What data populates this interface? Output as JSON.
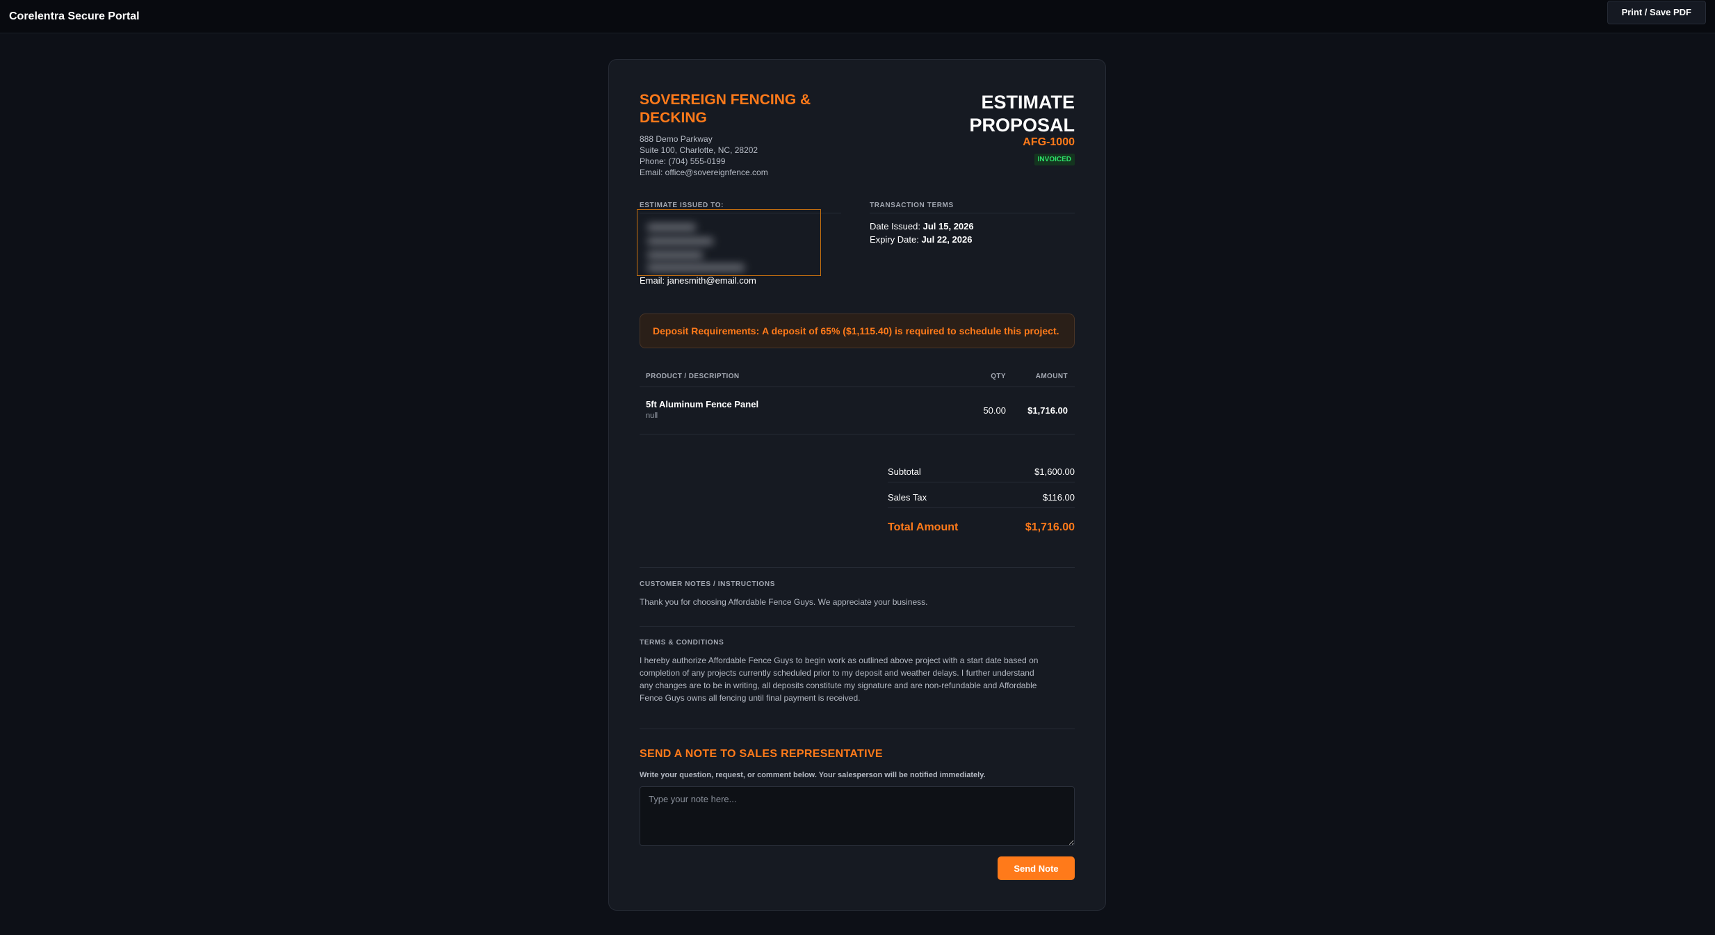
{
  "portal": {
    "title": "Corelentra Secure Portal",
    "print_label": "Print / Save PDF"
  },
  "company": {
    "name": "SOVEREIGN FENCING & DECKING",
    "address_line1": "888 Demo Parkway",
    "address_line2": "Suite 100, Charlotte, NC, 28202",
    "phone": "Phone: (704) 555-0199",
    "email": "Email: office@sovereignfence.com"
  },
  "document": {
    "title": "ESTIMATE PROPOSAL",
    "number": "AFG-1000",
    "status": "INVOICED"
  },
  "issued_to": {
    "label": "ESTIMATE ISSUED TO:",
    "email_label": "Email:",
    "email": "janesmith@email.com"
  },
  "terms_box": {
    "label": "TRANSACTION TERMS",
    "date_issued_label": "Date Issued:",
    "date_issued": "Jul 15, 2026",
    "expiry_label": "Expiry Date:",
    "expiry": "Jul 22, 2026"
  },
  "deposit": {
    "label": "Deposit Requirements:",
    "text": "A deposit of 65% ($1,115.40) is required to schedule this project."
  },
  "table": {
    "headers": {
      "description": "PRODUCT / DESCRIPTION",
      "qty": "QTY",
      "amount": "AMOUNT"
    },
    "rows": [
      {
        "name": "5ft Aluminum Fence Panel",
        "desc": "null",
        "qty": "50.00",
        "amount": "$1,716.00"
      }
    ]
  },
  "totals": {
    "subtotal_label": "Subtotal",
    "subtotal": "$1,600.00",
    "tax_label": "Sales Tax",
    "tax": "$116.00",
    "total_label": "Total Amount",
    "total": "$1,716.00"
  },
  "notes": {
    "label": "CUSTOMER NOTES / INSTRUCTIONS",
    "text": "Thank you for choosing Affordable Fence Guys. We appreciate your business."
  },
  "terms_conditions": {
    "label": "TERMS & CONDITIONS",
    "lines": [
      "I hereby authorize Affordable Fence Guys to begin work as outlined above project with a start date based on",
      "completion of any projects currently scheduled prior to my deposit and weather delays. I further understand",
      "any changes are to be in writing, all deposits constitute my signature and are non-refundable and Affordable",
      "Fence Guys owns all fencing until final payment is received."
    ]
  },
  "send_note": {
    "heading": "SEND A NOTE TO SALES REPRESENTATIVE",
    "subtext": "Write your question, request, or comment below. Your salesperson will be notified immediately.",
    "placeholder": "Type your note here...",
    "button_label": "Send Note"
  },
  "colors": {
    "accent": "#ff7a1a",
    "background": "#0d1017",
    "card": "#161a22",
    "success": "#2ee36a"
  }
}
